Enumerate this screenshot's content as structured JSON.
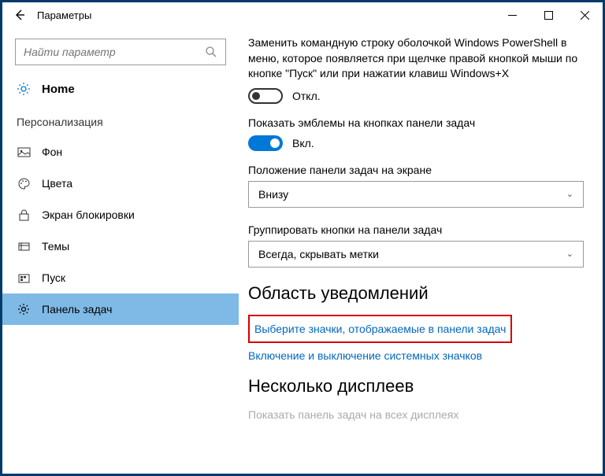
{
  "window": {
    "title": "Параметры"
  },
  "search": {
    "placeholder": "Найти параметр"
  },
  "sidebar": {
    "home": "Home",
    "section": "Персонализация",
    "items": [
      {
        "label": "Фон"
      },
      {
        "label": "Цвета"
      },
      {
        "label": "Экран блокировки"
      },
      {
        "label": "Темы"
      },
      {
        "label": "Пуск"
      },
      {
        "label": "Панель задач"
      }
    ]
  },
  "main": {
    "powershell_text": "Заменить командную строку оболочкой Windows PowerShell в меню, которое появляется при щелчке правой кнопкой мыши по кнопке \"Пуск\" или при нажатии клавиш Windows+X",
    "off_label": "Откл.",
    "badges_label": "Показать эмблемы на кнопках панели задач",
    "on_label": "Вкл.",
    "position_label": "Положение панели задач на экране",
    "position_value": "Внизу",
    "group_label": "Группировать кнопки на панели задач",
    "group_value": "Всегда, скрывать метки",
    "notif_heading": "Область уведомлений",
    "link_icons": "Выберите значки, отображаемые в панели задач",
    "link_system": "Включение и выключение системных значков",
    "multi_heading": "Несколько дисплеев",
    "multi_text": "Показать панель задач на всех дисплеях"
  }
}
